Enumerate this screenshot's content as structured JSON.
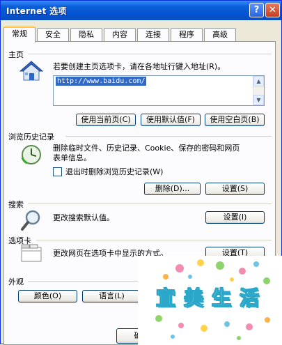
{
  "window": {
    "title": "Internet 选项",
    "help_glyph": "?",
    "close_glyph": "✕"
  },
  "tabs": [
    {
      "label": "常规",
      "active": true
    },
    {
      "label": "安全"
    },
    {
      "label": "隐私"
    },
    {
      "label": "内容"
    },
    {
      "label": "连接"
    },
    {
      "label": "程序"
    },
    {
      "label": "高级"
    }
  ],
  "home": {
    "label": "主页",
    "description": "若要创建主页选项卡，请在各地址行键入地址(R)。",
    "url": "http://www.baidu.com/",
    "buttons": [
      "使用当前页(C)",
      "使用默认值(F)",
      "使用空白页(B)"
    ]
  },
  "history": {
    "label": "浏览历史记录",
    "description_line1": "删除临时文件、历史记录、Cookie、保存的密码和网页",
    "description_line2": "表单信息。",
    "checkbox_label": "退出时删除浏览历史记录(W)",
    "delete_button": "删除(D)...",
    "settings_button": "设置(S)"
  },
  "search": {
    "label": "搜索",
    "description": "更改搜索默认值。",
    "settings_button": "设置(I)"
  },
  "tabs_section": {
    "label": "选项卡",
    "description": "更改网页在选项卡中显示的方式。",
    "settings_button": "设置(T)"
  },
  "appearance": {
    "label": "外观",
    "colors_button": "颜色(O)",
    "languages_button": "语言(L)"
  },
  "footer": {
    "ok_button": "确"
  },
  "watermark": {
    "chars": [
      "宜",
      "美",
      "生",
      "活"
    ],
    "color": "#2aa7c9"
  },
  "icons": {
    "home": "house-icon",
    "history": "clock-icon",
    "search": "magnifier-icon",
    "tabs": "tabs-icon"
  }
}
